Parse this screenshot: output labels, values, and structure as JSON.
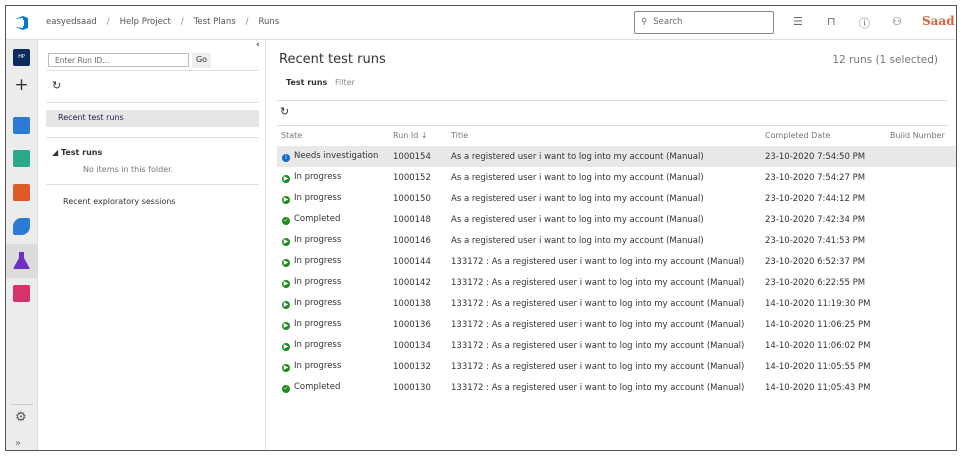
{
  "breadcrumb": [
    "easyedsaad",
    "Help Project",
    "Test Plans",
    "Runs"
  ],
  "search": {
    "placeholder": "Search"
  },
  "user": {
    "avatar_text": "Saad"
  },
  "leftnav": {
    "project_badge": "HP"
  },
  "panel": {
    "run_id_placeholder": "Enter Run ID...",
    "go_label": "Go",
    "recent_test_runs": "Recent test runs",
    "test_runs_header": "Test runs",
    "no_items": "No items in this folder.",
    "recent_exploratory": "Recent exploratory sessions"
  },
  "main": {
    "title": "Recent test runs",
    "count": "12 runs (1 selected)",
    "tabs": [
      "Test runs",
      "Filter"
    ],
    "columns": [
      "State",
      "Run Id",
      "Title",
      "Completed Date",
      "Build Number"
    ],
    "status_colors": {
      "Needs investigation": "#0a6ed1",
      "In progress": "#1f8a1f",
      "Completed": "#1f8a1f"
    },
    "rows": [
      {
        "state": "Needs investigation",
        "id": "1000154",
        "title": "As a registered user i want to log into my account (Manual)",
        "date": "23-10-2020 7:54:50 PM",
        "build": ""
      },
      {
        "state": "In progress",
        "id": "1000152",
        "title": "As a registered user i want to log into my account (Manual)",
        "date": "23-10-2020 7:54:27 PM",
        "build": ""
      },
      {
        "state": "In progress",
        "id": "1000150",
        "title": "As a registered user i want to log into my account (Manual)",
        "date": "23-10-2020 7:44:12 PM",
        "build": ""
      },
      {
        "state": "Completed",
        "id": "1000148",
        "title": "As a registered user i want to log into my account (Manual)",
        "date": "23-10-2020 7:42:34 PM",
        "build": ""
      },
      {
        "state": "In progress",
        "id": "1000146",
        "title": "As a registered user i want to log into my account (Manual)",
        "date": "23-10-2020 7:41:53 PM",
        "build": ""
      },
      {
        "state": "In progress",
        "id": "1000144",
        "title": "133172 : As a registered user i want to log into my account (Manual)",
        "date": "23-10-2020 6:52:37 PM",
        "build": ""
      },
      {
        "state": "In progress",
        "id": "1000142",
        "title": "133172 : As a registered user i want to log into my account (Manual)",
        "date": "23-10-2020 6:22:55 PM",
        "build": ""
      },
      {
        "state": "In progress",
        "id": "1000138",
        "title": "133172 : As a registered user i want to log into my account (Manual)",
        "date": "14-10-2020 11:19:30 PM",
        "build": ""
      },
      {
        "state": "In progress",
        "id": "1000136",
        "title": "133172 : As a registered user i want to log into my account (Manual)",
        "date": "14-10-2020 11:06:25 PM",
        "build": ""
      },
      {
        "state": "In progress",
        "id": "1000134",
        "title": "133172 : As a registered user i want to log into my account (Manual)",
        "date": "14-10-2020 11:06:02 PM",
        "build": ""
      },
      {
        "state": "In progress",
        "id": "1000132",
        "title": "133172 : As a registered user i want to log into my account (Manual)",
        "date": "14-10-2020 11:05:55 PM",
        "build": ""
      },
      {
        "state": "Completed",
        "id": "1000130",
        "title": "133172 : As a registered user i want to log into my account (Manual)",
        "date": "14-10-2020 11:05:43 PM",
        "build": ""
      }
    ]
  }
}
